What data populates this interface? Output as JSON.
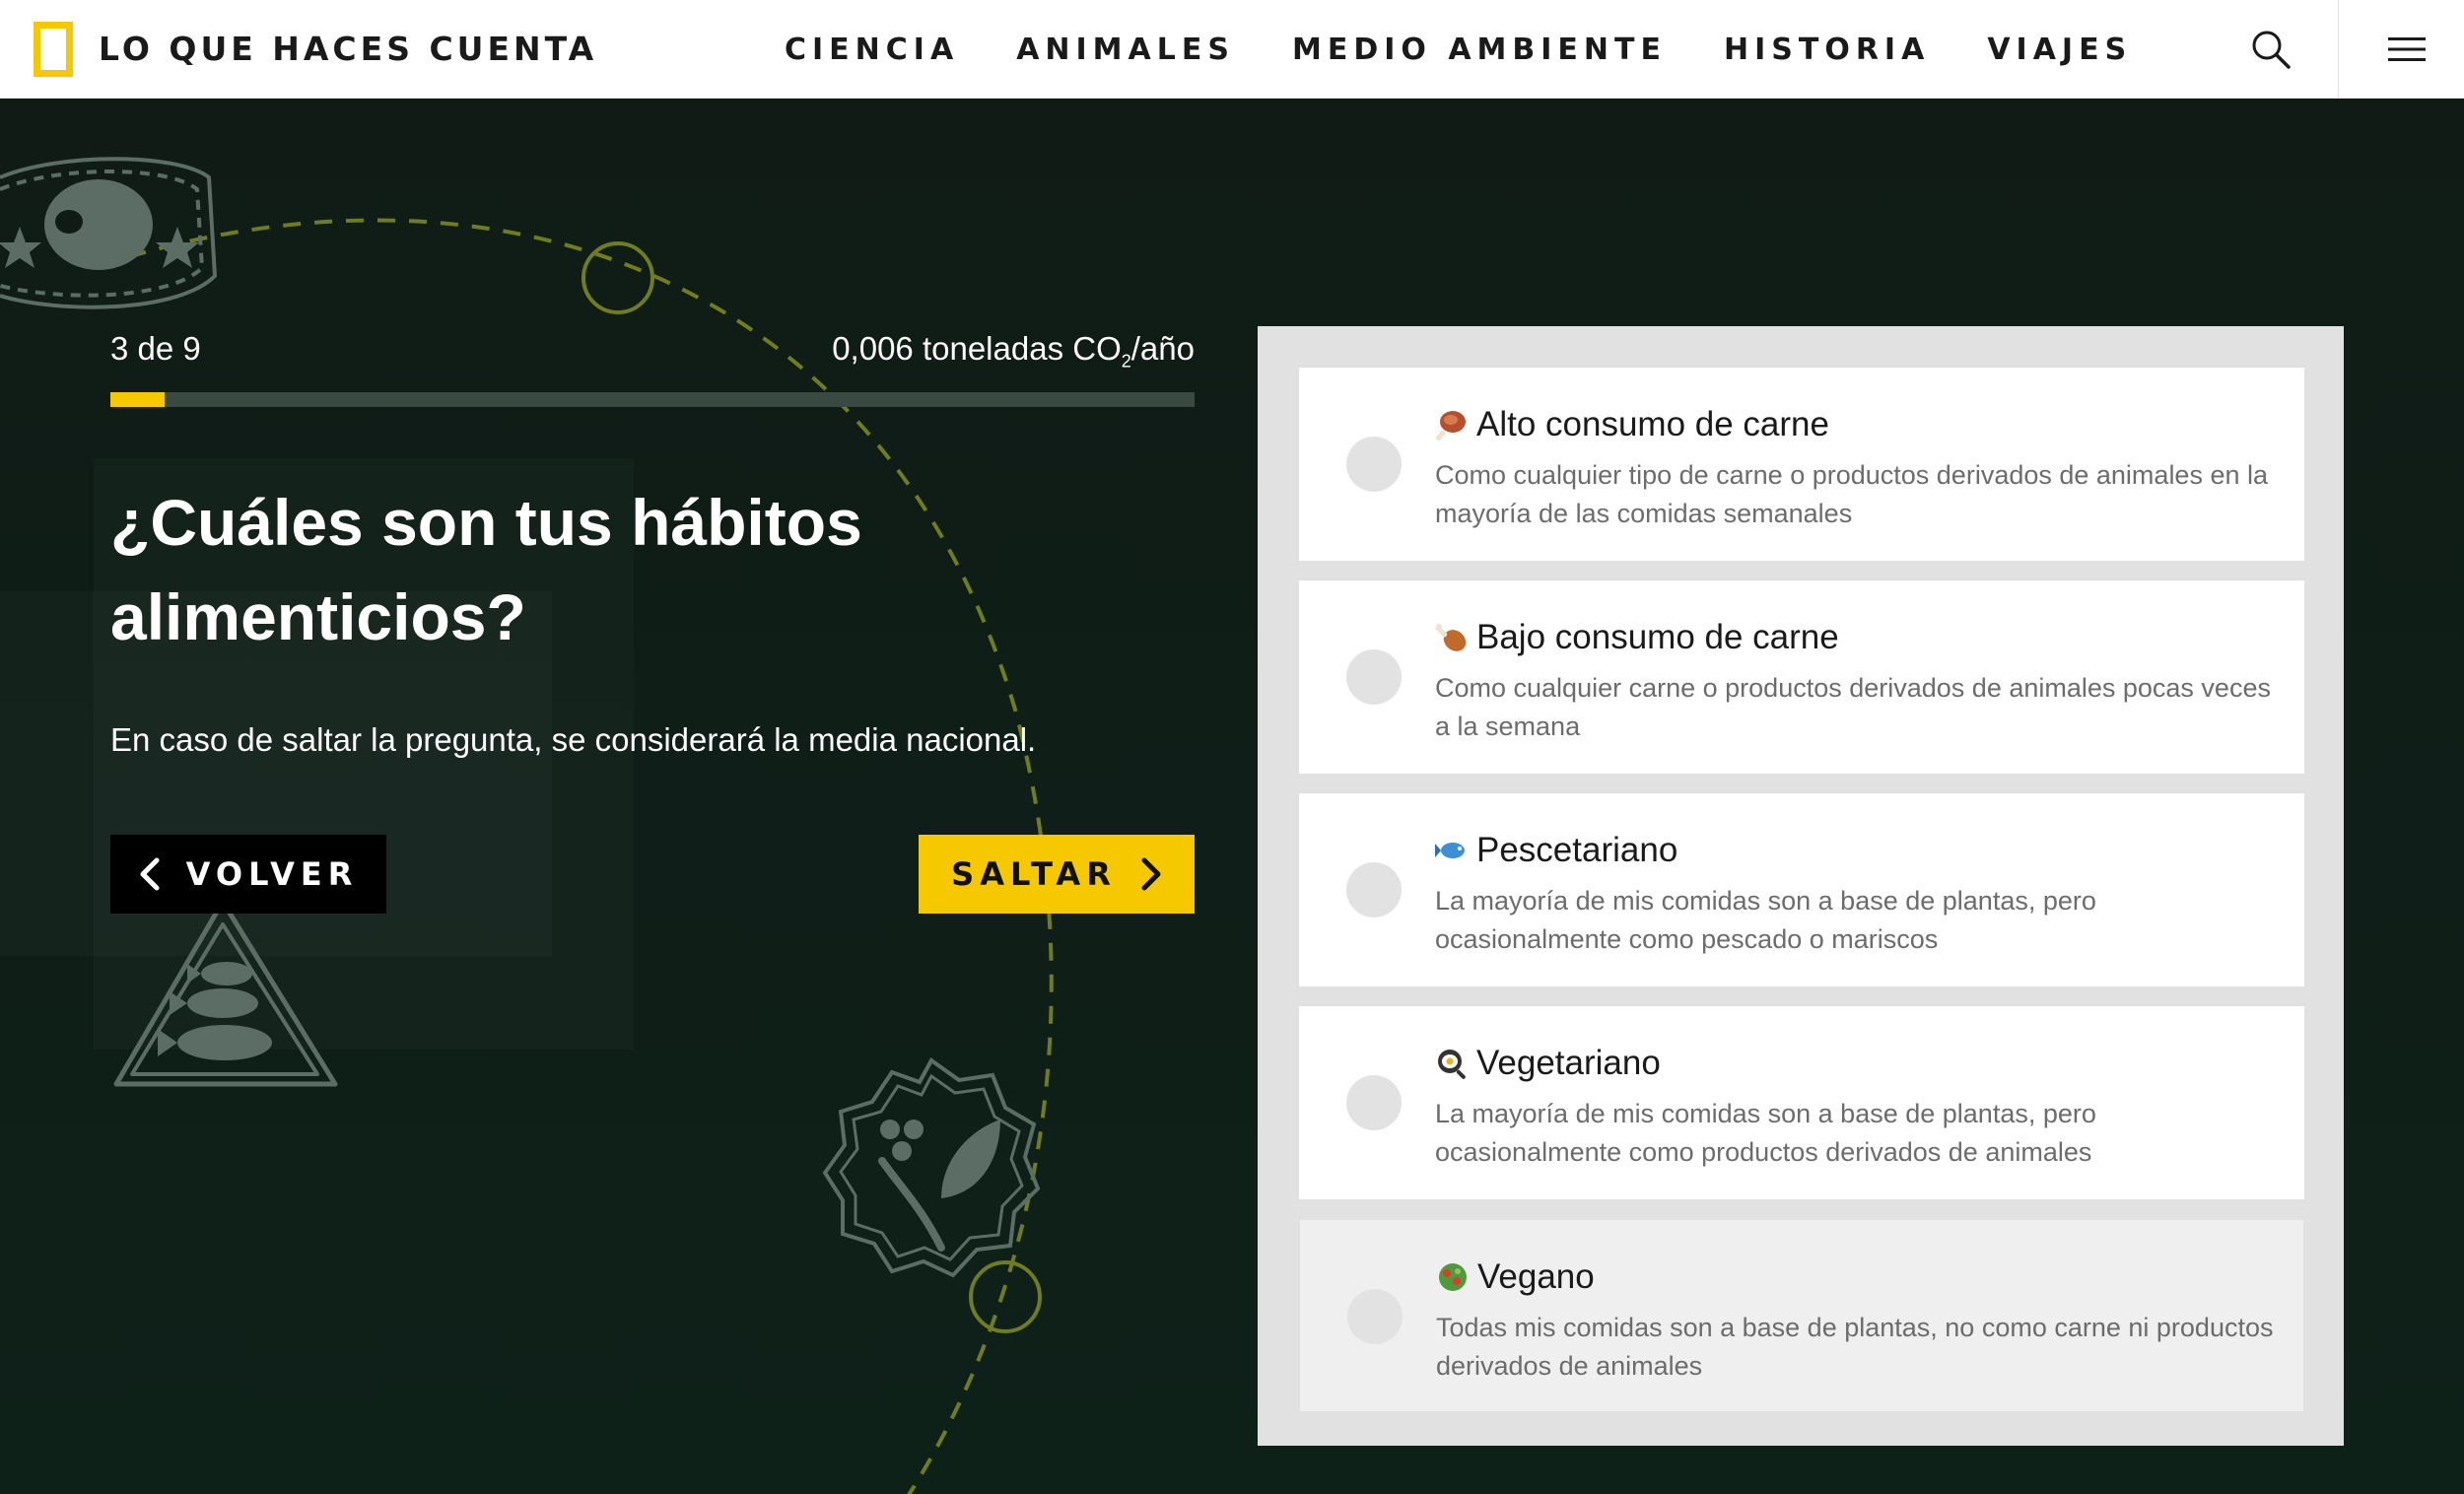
{
  "header": {
    "brand": "LO QUE HACES CUENTA",
    "nav": [
      "CIENCIA",
      "ANIMALES",
      "MEDIO AMBIENTE",
      "HISTORIA",
      "VIAJES"
    ],
    "icons": {
      "search": "search-icon",
      "menu": "hamburger-menu-icon",
      "logo": "yellow-frame-logo"
    }
  },
  "progress": {
    "step_text": "3 de 9",
    "co2_value": "0,006 toneladas CO",
    "co2_sub": "2",
    "co2_unit": "/año",
    "fraction": 0.05
  },
  "question": {
    "title": "¿Cuáles son tus hábitos alimenticios?",
    "note": "En caso de saltar la pregunta, se considerará la media nacional."
  },
  "buttons": {
    "back": "VOLVER",
    "skip": "SALTAR"
  },
  "options": [
    {
      "emoji": "meat-on-bone-icon",
      "title": "Alto consumo de carne",
      "desc": "Como cualquier tipo de carne o productos derivados de animales en la mayoría de las comidas semanales"
    },
    {
      "emoji": "poultry-leg-icon",
      "title": "Bajo consumo de carne",
      "desc": "Como cualquier carne o productos derivados de animales pocas veces a la semana"
    },
    {
      "emoji": "fish-icon",
      "title": "Pescetariano",
      "desc": "La mayoría de mis comidas son a base de plantas, pero ocasionalmente como pescado o mariscos"
    },
    {
      "emoji": "fried-egg-icon",
      "title": "Vegetariano",
      "desc": "La mayoría de mis comidas son a base de plantas, pero ocasionalmente como productos derivados de animales"
    },
    {
      "emoji": "salad-icon",
      "title": "Vegano",
      "desc": "Todas mis comidas son a base de plantas, no como carne ni productos derivados de animales"
    }
  ],
  "colors": {
    "accent": "#f5c800",
    "background": "#0f1f18",
    "panel": "#e1e1e1"
  }
}
